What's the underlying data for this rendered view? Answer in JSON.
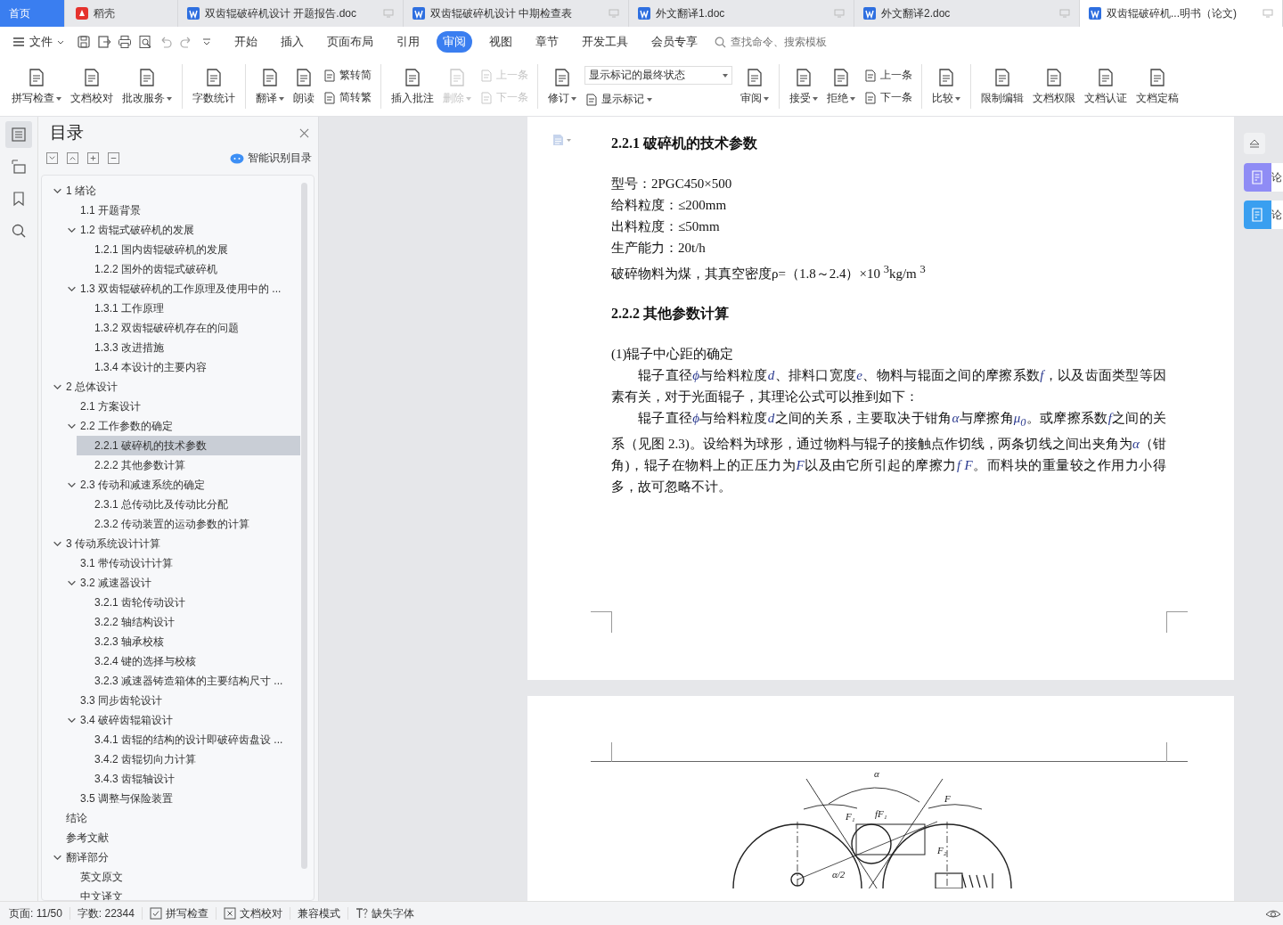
{
  "tabs": [
    {
      "kind": "home",
      "label": "首页",
      "selected": false
    },
    {
      "kind": "docer",
      "label": "稻壳",
      "selected": false
    },
    {
      "kind": "doc",
      "label": "双齿辊破碎机设计 开题报告.doc",
      "selected": false
    },
    {
      "kind": "doc",
      "label": "双齿辊破碎机设计 中期检查表",
      "selected": false
    },
    {
      "kind": "doc",
      "label": "外文翻译1.doc",
      "selected": false
    },
    {
      "kind": "doc",
      "label": "外文翻译2.doc",
      "selected": false
    },
    {
      "kind": "doc",
      "label": "双齿辊破碎机...明书（论文)",
      "selected": true
    }
  ],
  "menu": {
    "file": "文件",
    "items": [
      {
        "label": "开始",
        "selected": false
      },
      {
        "label": "插入",
        "selected": false
      },
      {
        "label": "页面布局",
        "selected": false
      },
      {
        "label": "引用",
        "selected": false
      },
      {
        "label": "审阅",
        "selected": true
      },
      {
        "label": "视图",
        "selected": false
      },
      {
        "label": "章节",
        "selected": false
      },
      {
        "label": "开发工具",
        "selected": false
      },
      {
        "label": "会员专享",
        "selected": false
      }
    ],
    "search": {
      "placeholder": "查找命令、搜索模板"
    }
  },
  "ribbon": [
    {
      "kind": "button",
      "label": "拼写检查",
      "dropdown": true,
      "disabled": false
    },
    {
      "kind": "button",
      "label": "文档校对",
      "dropdown": false,
      "disabled": false
    },
    {
      "kind": "button",
      "label": "批改服务",
      "dropdown": true,
      "disabled": false
    },
    {
      "kind": "separator"
    },
    {
      "kind": "button",
      "label": "字数统计",
      "dropdown": false,
      "disabled": false
    },
    {
      "kind": "separator"
    },
    {
      "kind": "button",
      "label": "翻译",
      "dropdown": true,
      "disabled": false
    },
    {
      "kind": "button",
      "label": "朗读",
      "dropdown": false,
      "disabled": false
    },
    {
      "kind": "stack",
      "items": [
        {
          "kind": "button",
          "label": "繁转简",
          "dropdown": false,
          "disabled": false
        },
        {
          "kind": "button",
          "label": "简转繁",
          "dropdown": false,
          "disabled": false
        }
      ]
    },
    {
      "kind": "separator"
    },
    {
      "kind": "button",
      "label": "插入批注",
      "dropdown": false,
      "disabled": false
    },
    {
      "kind": "button",
      "label": "删除",
      "dropdown": true,
      "disabled": true
    },
    {
      "kind": "stack",
      "items": [
        {
          "kind": "button",
          "label": "上一条",
          "dropdown": false,
          "disabled": true
        },
        {
          "kind": "button",
          "label": "下一条",
          "dropdown": false,
          "disabled": true
        }
      ]
    },
    {
      "kind": "separator"
    },
    {
      "kind": "button",
      "label": "修订",
      "dropdown": true,
      "disabled": false
    },
    {
      "kind": "stack",
      "items": [
        {
          "kind": "select",
          "label": "显示标记的最终状态"
        },
        {
          "kind": "button",
          "label": "显示标记",
          "dropdown": true,
          "disabled": false
        }
      ]
    },
    {
      "kind": "button",
      "label": "审阅",
      "dropdown": true,
      "disabled": false
    },
    {
      "kind": "separator"
    },
    {
      "kind": "button",
      "label": "接受",
      "dropdown": true,
      "disabled": false
    },
    {
      "kind": "button",
      "label": "拒绝",
      "dropdown": true,
      "disabled": false
    },
    {
      "kind": "stack",
      "items": [
        {
          "kind": "button",
          "label": "上一条",
          "dropdown": false,
          "disabled": false
        },
        {
          "kind": "button",
          "label": "下一条",
          "dropdown": false,
          "disabled": false
        }
      ]
    },
    {
      "kind": "separator"
    },
    {
      "kind": "button",
      "label": "比较",
      "dropdown": true,
      "disabled": false
    },
    {
      "kind": "separator"
    },
    {
      "kind": "button",
      "label": "限制编辑",
      "dropdown": false,
      "disabled": false
    },
    {
      "kind": "button",
      "label": "文档权限",
      "dropdown": false,
      "disabled": false
    },
    {
      "kind": "button",
      "label": "文档认证",
      "dropdown": false,
      "disabled": false
    },
    {
      "kind": "button",
      "label": "文档定稿",
      "dropdown": false,
      "disabled": false
    }
  ],
  "left_rail": [
    {
      "kind": "toc",
      "selected": true
    },
    {
      "kind": "outline",
      "selected": false
    },
    {
      "kind": "bookmark",
      "selected": false
    },
    {
      "kind": "search",
      "selected": false
    }
  ],
  "toc": {
    "title": "目录",
    "smart_button": "智能识别目录",
    "items": [
      {
        "label": "1  绪论",
        "selected": false,
        "expanded": true,
        "children": [
          {
            "label": "1.1 开题背景",
            "selected": false
          },
          {
            "label": "1.2 齿辊式破碎机的发展",
            "selected": false,
            "expanded": true,
            "children": [
              {
                "label": "1.2.1 国内齿辊破碎机的发展",
                "selected": false
              },
              {
                "label": "1.2.2 国外的齿辊式破碎机",
                "selected": false
              }
            ]
          },
          {
            "label": "1.3 双齿辊破碎机的工作原理及使用中的 ...",
            "selected": false,
            "expanded": true,
            "children": [
              {
                "label": "1.3.1 工作原理",
                "selected": false
              },
              {
                "label": "1.3.2 双齿辊破碎机存在的问题",
                "selected": false
              },
              {
                "label": "1.3.3 改进措施",
                "selected": false
              },
              {
                "label": "1.3.4 本设计的主要内容",
                "selected": false
              }
            ]
          }
        ]
      },
      {
        "label": "2  总体设计",
        "selected": false,
        "expanded": true,
        "children": [
          {
            "label": "2.1 方案设计",
            "selected": false
          },
          {
            "label": "2.2 工作参数的确定",
            "selected": false,
            "expanded": true,
            "children": [
              {
                "label": "2.2.1 破碎机的技术参数",
                "selected": true
              },
              {
                "label": "2.2.2 其他参数计算",
                "selected": false
              }
            ]
          },
          {
            "label": "2.3 传动和减速系统的确定",
            "selected": false,
            "expanded": true,
            "children": [
              {
                "label": "2.3.1 总传动比及传动比分配",
                "selected": false
              },
              {
                "label": "2.3.2 传动装置的运动参数的计算",
                "selected": false
              }
            ]
          }
        ]
      },
      {
        "label": "3  传动系统设计计算",
        "selected": false,
        "expanded": true,
        "children": [
          {
            "label": "3.1  带传动设计计算",
            "selected": false
          },
          {
            "label": "3.2 减速器设计",
            "selected": false,
            "expanded": true,
            "children": [
              {
                "label": "3.2.1 齿轮传动设计",
                "selected": false
              },
              {
                "label": "3.2.2 轴结构设计",
                "selected": false
              },
              {
                "label": "3.2.3 轴承校核",
                "selected": false
              },
              {
                "label": "3.2.4 键的选择与校核",
                "selected": false
              },
              {
                "label": "3.2.3 减速器铸造箱体的主要结构尺寸 ...",
                "selected": false
              }
            ]
          },
          {
            "label": "3.3 同步齿轮设计",
            "selected": false
          },
          {
            "label": "3.4 破碎齿辊箱设计",
            "selected": false,
            "expanded": true,
            "children": [
              {
                "label": "3.4.1 齿辊的结构的设计即破碎齿盘设 ...",
                "selected": false
              },
              {
                "label": "3.4.2 齿辊切向力计算",
                "selected": false
              },
              {
                "label": "3.4.3 齿辊轴设计",
                "selected": false
              }
            ]
          },
          {
            "label": "3.5 调整与保险装置",
            "selected": false
          }
        ]
      },
      {
        "label": "结论",
        "selected": false
      },
      {
        "label": "参考文献",
        "selected": false
      },
      {
        "label": "翻译部分",
        "selected": false,
        "expanded": true,
        "children": [
          {
            "label": "英文原文",
            "selected": false
          },
          {
            "label": "中文译文",
            "selected": false
          }
        ]
      }
    ]
  },
  "document": {
    "blocks": [
      {
        "kind": "heading",
        "text": "2.2.1 破碎机的技术参数"
      },
      {
        "kind": "line",
        "text": "型号：2PGC450×500"
      },
      {
        "kind": "line",
        "text": "给料粒度：≤200mm"
      },
      {
        "kind": "line",
        "text": "出料粒度：≤50mm"
      },
      {
        "kind": "line",
        "text": "生产能力：20t/h"
      },
      {
        "kind": "line",
        "text": "破碎物料为煤，其真空密度ρ=（1.8～2.4）×10 $^{3}$kg/m $^{3}$"
      },
      {
        "kind": "heading",
        "text": "2.2.2 其他参数计算"
      },
      {
        "kind": "line",
        "text": "(1)辊子中心距的确定"
      },
      {
        "kind": "paragraph",
        "segments": [
          {
            "kind": "plain",
            "text": "辊子直径"
          },
          {
            "kind": "math",
            "text": "ϕ"
          },
          {
            "kind": "plain",
            "text": "与给料粒度"
          },
          {
            "kind": "math",
            "text": "d"
          },
          {
            "kind": "plain",
            "text": "、排料口宽度"
          },
          {
            "kind": "math",
            "text": "e"
          },
          {
            "kind": "plain",
            "text": "、物料与辊面之间的摩擦系数"
          },
          {
            "kind": "math",
            "text": "f"
          },
          {
            "kind": "plain",
            "text": "，以及齿面类型等因素有关，对于光面辊子，其理论公式可以推到如下："
          }
        ]
      },
      {
        "kind": "paragraph",
        "segments": [
          {
            "kind": "plain",
            "text": "辊子直径"
          },
          {
            "kind": "math",
            "text": "ϕ"
          },
          {
            "kind": "plain",
            "text": "与给料粒度"
          },
          {
            "kind": "math",
            "text": "d"
          },
          {
            "kind": "plain",
            "text": "之间的关系，主要取决于钳角"
          },
          {
            "kind": "math",
            "text": "α"
          },
          {
            "kind": "plain",
            "text": "与摩擦角"
          },
          {
            "kind": "math",
            "text": "μ$_{0}$"
          },
          {
            "kind": "plain",
            "text": "。或摩擦系数"
          },
          {
            "kind": "math",
            "text": "f"
          },
          {
            "kind": "plain",
            "text": "之间的关系（见图 2.3)。设给料为球形，通过物料与辊子的接触点作切线，两条切线之间出夹角为"
          },
          {
            "kind": "math",
            "text": "α"
          },
          {
            "kind": "plain",
            "text": "（钳角)，辊子在物料上的正压力为"
          },
          {
            "kind": "math",
            "text": "F"
          },
          {
            "kind": "plain",
            "text": "以及由它所引起的摩擦力"
          },
          {
            "kind": "math",
            "text": "f F"
          },
          {
            "kind": "plain",
            "text": "。而料块的重量较之作用力小得多，故可忽略不计。"
          }
        ]
      }
    ],
    "figure_labels": [
      {
        "text": "α"
      },
      {
        "text": "F₁"
      },
      {
        "text": "fF₁"
      },
      {
        "text": "F"
      },
      {
        "text": "F₂"
      },
      {
        "text": "α/2"
      }
    ]
  },
  "side_buttons": [
    {
      "kind": "review",
      "label": "论"
    },
    {
      "kind": "paper",
      "label": "论"
    }
  ],
  "status_bar": [
    {
      "kind": "text",
      "label": "页面: 11/50"
    },
    {
      "kind": "text",
      "label": "字数: 22344"
    },
    {
      "kind": "check",
      "label": "拼写检查"
    },
    {
      "kind": "cross",
      "label": "文档校对"
    },
    {
      "kind": "text",
      "label": "兼容模式"
    },
    {
      "kind": "font",
      "label": "缺失字体"
    }
  ]
}
